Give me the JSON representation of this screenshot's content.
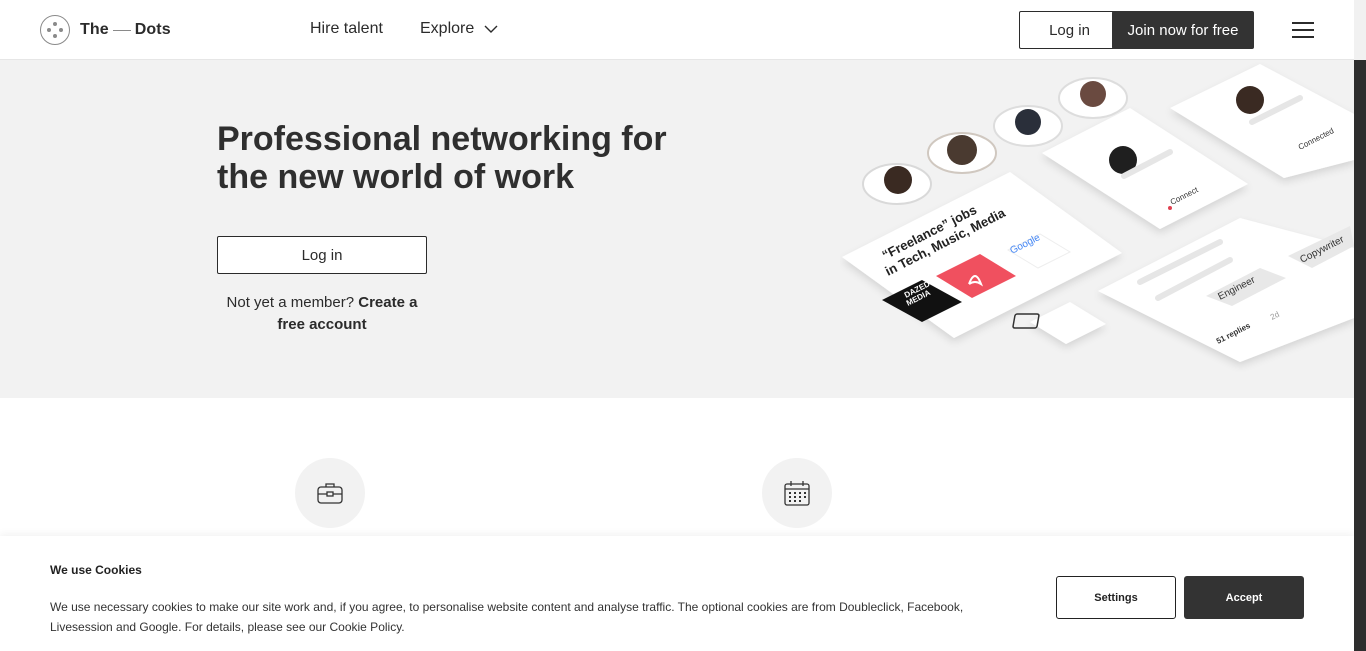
{
  "header": {
    "brand_left": "The",
    "brand_right": "Dots",
    "nav": {
      "hire_talent": "Hire talent",
      "explore": "Explore"
    },
    "login_label": "Log in",
    "join_label": "Join now for free"
  },
  "hero": {
    "title": "Professional networking for the new world of work",
    "login_label": "Log in",
    "member_prompt": "Not yet a member?",
    "create_account": "Create a free account"
  },
  "illustration": {
    "jobs_line1": "“Freelance” jobs",
    "jobs_line2": "in Tech, Music, Media",
    "google_logo": "Google",
    "dazed_line1": "DAZED",
    "dazed_line2": "MEDIA",
    "connect": "Connect",
    "connected": "Connected",
    "tag_engineer": "Engineer",
    "tag_copywriter": "Copywriter",
    "replies": "51 replies",
    "time_ago": "2d"
  },
  "features": {
    "icons": [
      "briefcase-icon",
      "calendar-icon"
    ]
  },
  "cookie": {
    "title": "We use Cookies",
    "text": "We use necessary cookies to make our site work and, if you agree, to personalise website content and analyse traffic. The optional cookies are from Doubleclick, Facebook, Livesession and Google. For details, please see our Cookie Policy.",
    "settings_label": "Settings",
    "accept_label": "Accept"
  },
  "colors": {
    "accent_dark": "#333333",
    "hero_bg": "#f2f2f2",
    "airbnb": "#f0505f"
  }
}
